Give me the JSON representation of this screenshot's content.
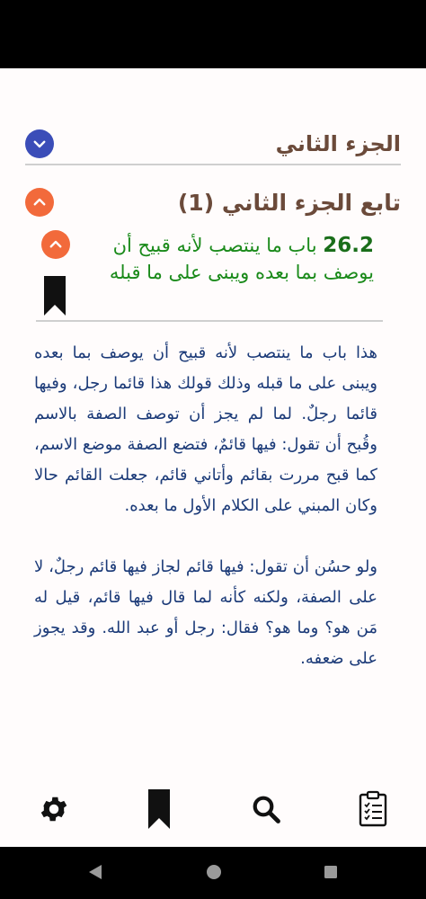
{
  "parts": {
    "part2_title": "الجزء الثاني",
    "part2_cont_title": "تابع الجزء الثاني (1)"
  },
  "chapter": {
    "number": "26.2",
    "title": "باب ما ينتصب لأنه قبيح أن يوصف بما بعده ويبنى على ما قبله"
  },
  "body": {
    "paragraphs": [
      "هذا باب ما ينتصب لأنه قبيح أن يوصف بما بعده ويبنى على ما قبله وذلك قولك هذا قائما رجل، وفيها قائما رجلٌ. لما لم يجز أن توصف الصفة بالاسم وقُبح أن تقول: فيها قائمٌ، فتضع الصفة موضع الاسم، كما قبح مررت بقائم وأتاني قائم، جعلت القائم حالا وكان المبني على الكلام الأول ما بعده.",
      "ولو حسُن أن تقول: فيها قائم لجاز فيها قائم رجلٌ، لا على الصفة، ولكنه كأنه لما قال فيها قائم، قيل له مَن هو؟ وما هو؟ فقال: رجل أو عبد الله. وقد يجوز على ضعفه."
    ]
  },
  "toolbar": {
    "items": [
      "settings-icon",
      "bookmark-icon",
      "search-icon",
      "clipboard-icon"
    ]
  },
  "colors": {
    "part_title": "#6b4a3a",
    "chapter_title": "#1a8a1a",
    "body_text": "#1b3a78",
    "blue_toggle": "#3b4db8",
    "orange_toggle": "#f26a3b"
  }
}
